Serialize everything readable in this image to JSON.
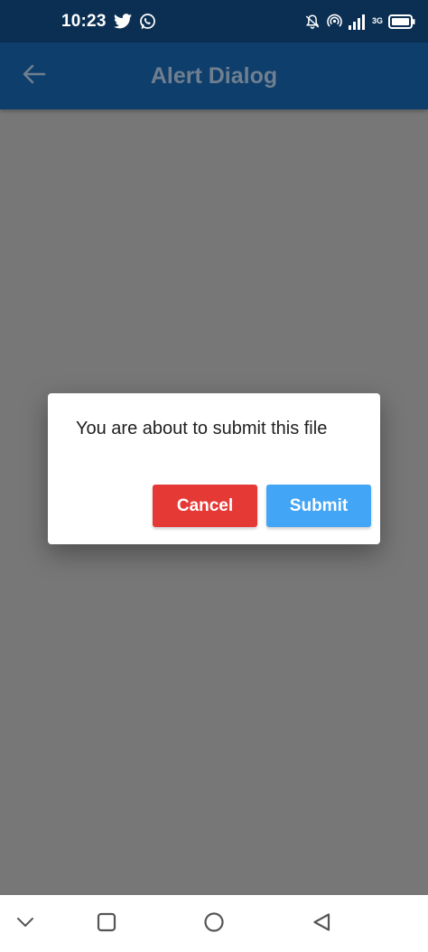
{
  "status_bar": {
    "time": "10:23",
    "network_type": "3G",
    "icons": [
      "twitter-icon",
      "whatsapp-icon",
      "alarm-icon",
      "hotspot-icon",
      "signal-icon",
      "battery-icon"
    ]
  },
  "app_bar": {
    "title": "Alert Dialog",
    "back_icon": "arrow-back-icon"
  },
  "dialog": {
    "message": "You are about to submit this file",
    "cancel_label": "Cancel",
    "submit_label": "Submit"
  },
  "nav_bar": {
    "icons": [
      "chevron-down-icon",
      "recents-square-icon",
      "home-circle-icon",
      "back-triangle-icon"
    ]
  },
  "colors": {
    "status_bar_bg": "#0b2f52",
    "app_bar_bg": "#0e3e6b",
    "scrim": "#777777",
    "cancel": "#e53935",
    "submit": "#42a5f5"
  }
}
